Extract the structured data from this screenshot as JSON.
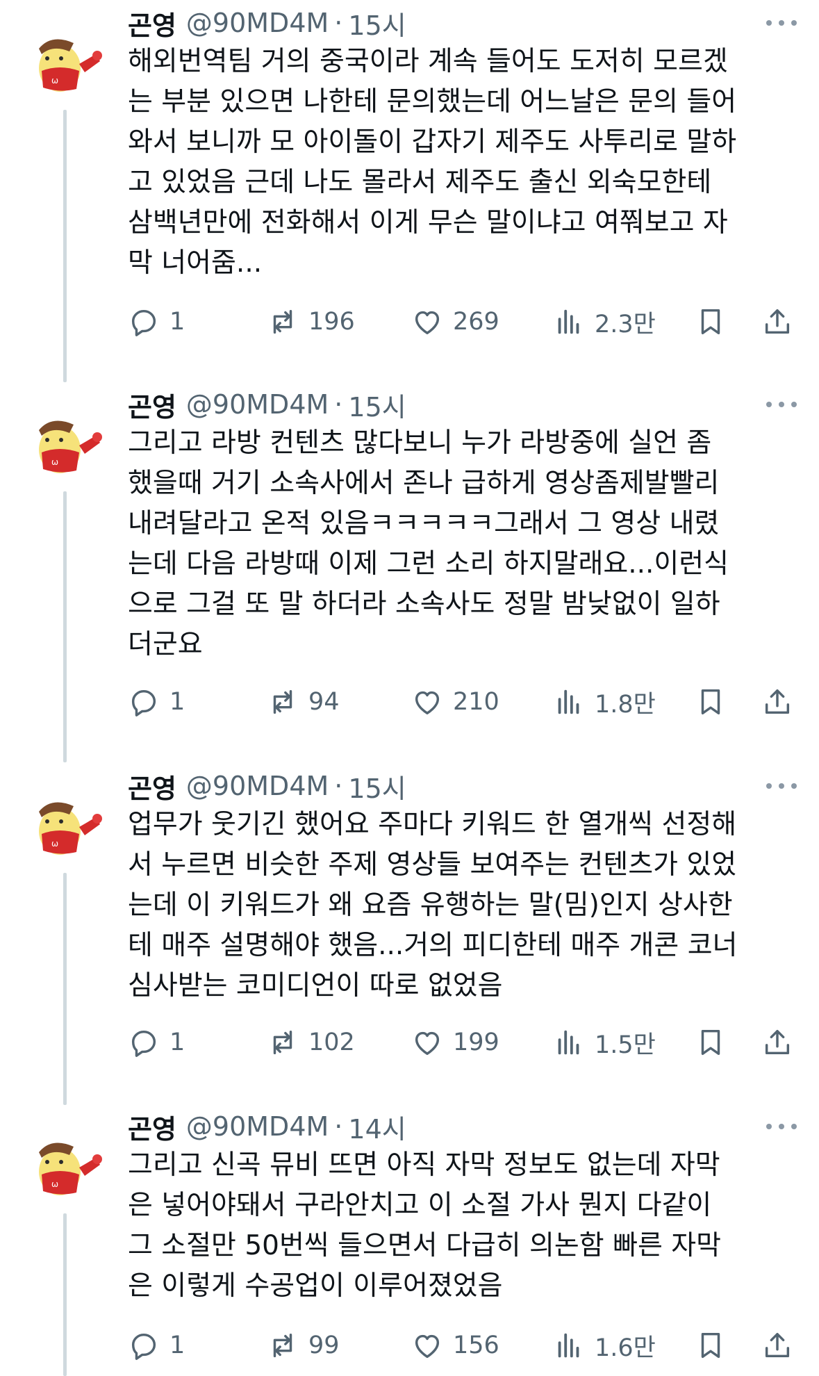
{
  "tweets": [
    {
      "name": "곤영",
      "handle": "@90MD4M",
      "separator": "·",
      "time": "15시",
      "text": "해외번역팀 거의 중국이라 계속 들어도 도저히 모르겠\n는 부분 있으면 나한테 문의했는데 어느날은 문의 들어\n와서 보니까 모 아이돌이 갑자기 제주도 사투리로 말하\n고 있었음 근데 나도 몰라서 제주도 출신 외숙모한테\n삼백년만에 전화해서 이게 무슨 말이냐고 여쭤보고 자\n막 너어줌...",
      "replies": "1",
      "retweets": "196",
      "likes": "269",
      "views": "2.3만"
    },
    {
      "name": "곤영",
      "handle": "@90MD4M",
      "separator": "·",
      "time": "15시",
      "text": "그리고 라방 컨텐츠 많다보니 누가 라방중에 실언 좀\n했을때 거기 소속사에서 존나 급하게 영상좀제발빨리\n내려달라고 온적 있음ㅋㅋㅋㅋㅋ그래서 그 영상 내렸\n는데 다음 라방때 이제 그런 소리 하지말래요...이런식\n으로 그걸 또 말 하더라 소속사도 정말 밤낮없이 일하\n더군요",
      "replies": "1",
      "retweets": "94",
      "likes": "210",
      "views": "1.8만"
    },
    {
      "name": "곤영",
      "handle": "@90MD4M",
      "separator": "·",
      "time": "15시",
      "text": "업무가 웃기긴 했어요 주마다 키워드 한 열개씩 선정해\n서 누르면 비슷한 주제 영상들 보여주는 컨텐츠가 있었\n는데 이 키워드가 왜 요즘 유행하는 말(밈)인지 상사한\n테 매주 설명해야 했음...거의 피디한테 매주 개콘 코너\n심사받는 코미디언이 따로 없었음",
      "replies": "1",
      "retweets": "102",
      "likes": "199",
      "views": "1.5만"
    },
    {
      "name": "곤영",
      "handle": "@90MD4M",
      "separator": "·",
      "time": "14시",
      "text": "그리고 신곡 뮤비 뜨면 아직 자막 정보도 없는데 자막\n은 넣어야돼서 구라안치고 이 소절 가사 뭔지 다같이\n그 소절만 50번씩 들으면서 다급히 의논함 빠른 자막\n은 이렇게 수공업이 이루어졌었음",
      "replies": "1",
      "retweets": "99",
      "likes": "156",
      "views": "1.6만"
    }
  ],
  "icons": {
    "reply": "reply-icon",
    "retweet": "retweet-icon",
    "like": "heart-icon",
    "views": "views-icon",
    "bookmark": "bookmark-icon",
    "share": "share-icon",
    "more": "more-icon",
    "avatar": "pompompurin-avatar"
  },
  "colors": {
    "text": "#0f1419",
    "muted": "#536471",
    "thread_line": "#cfd9de"
  }
}
